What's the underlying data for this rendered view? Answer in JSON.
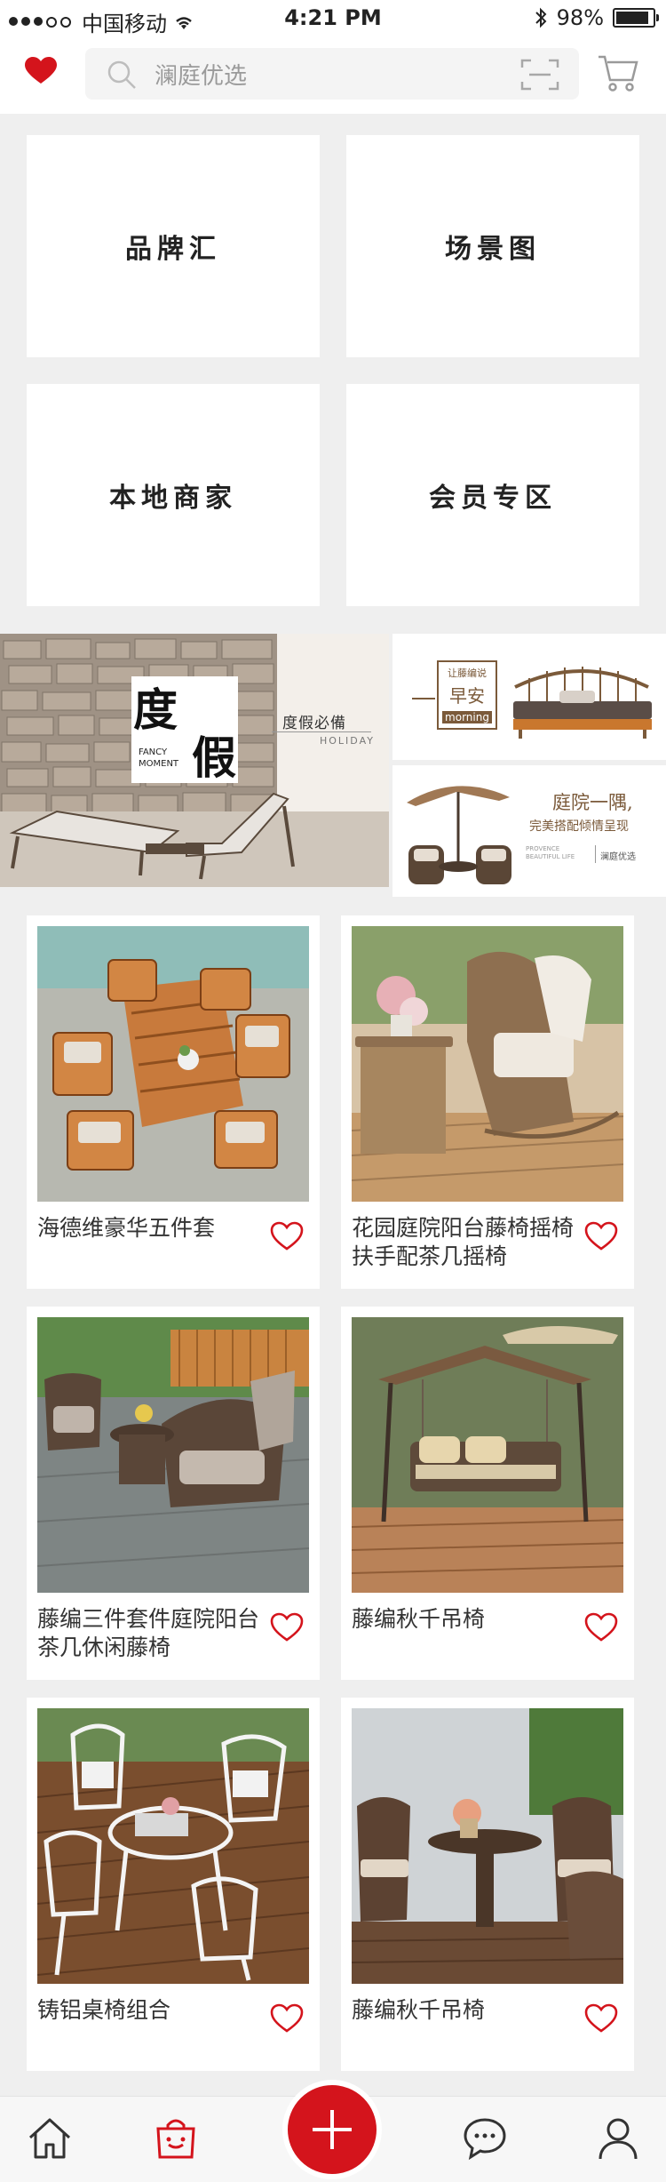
{
  "status_bar": {
    "carrier": "中国移动",
    "time": "4:21 PM",
    "battery": "98%"
  },
  "header": {
    "search_placeholder": "澜庭优选"
  },
  "categories": [
    {
      "label": "品牌汇"
    },
    {
      "label": "场景图"
    },
    {
      "label": "本地商家"
    },
    {
      "label": "会员专区"
    }
  ],
  "banners": {
    "holiday": {
      "big1": "度",
      "big2": "假",
      "en1": "FANCY",
      "en2": "MOMENT",
      "tag": "度假必備",
      "tag_en": "HOLIDAY"
    },
    "morning": {
      "line1": "让藤编说",
      "line2": "早安",
      "line3": "morning"
    },
    "garden": {
      "line1": "庭院一隅,",
      "line2": "完美搭配倾情呈现",
      "en": "PROVENCE BEAUTIFUL LIFE",
      "brand": "澜庭优选"
    }
  },
  "products": [
    {
      "title": "海德维豪华五件套"
    },
    {
      "title": "花园庭院阳台藤椅摇椅扶手配茶几摇椅"
    },
    {
      "title": "藤编三件套件庭院阳台茶几休闲藤椅"
    },
    {
      "title": "藤编秋千吊椅"
    },
    {
      "title": "铸铝桌椅组合"
    },
    {
      "title": "藤编秋千吊椅"
    }
  ],
  "colors": {
    "accent": "#d4141c",
    "background": "#efefef"
  },
  "tabbar": {
    "icons": [
      "home-icon",
      "bag-icon",
      "plus-icon",
      "chat-icon",
      "user-icon"
    ]
  }
}
